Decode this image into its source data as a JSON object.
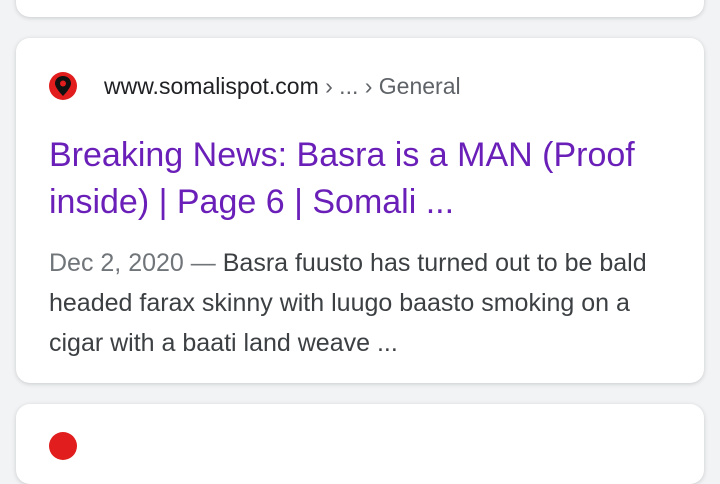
{
  "result": {
    "favicon": "somalispot-favicon-icon",
    "url_domain": "www.somalispot.com",
    "url_path": " › ... › General",
    "title": "Breaking News: Basra is a MAN (Proof inside) | Page 6 | Somali ...",
    "date": "Dec 2, 2020",
    "separator": " — ",
    "snippet": "Basra fuusto has turned out to be bald headed farax skinny with luugo baasto smoking on a cigar with a baati land weave ..."
  },
  "colors": {
    "background": "#f1f3f4",
    "card": "#ffffff",
    "title_visited": "#6a1fb8",
    "favicon": "#e11d1d"
  }
}
